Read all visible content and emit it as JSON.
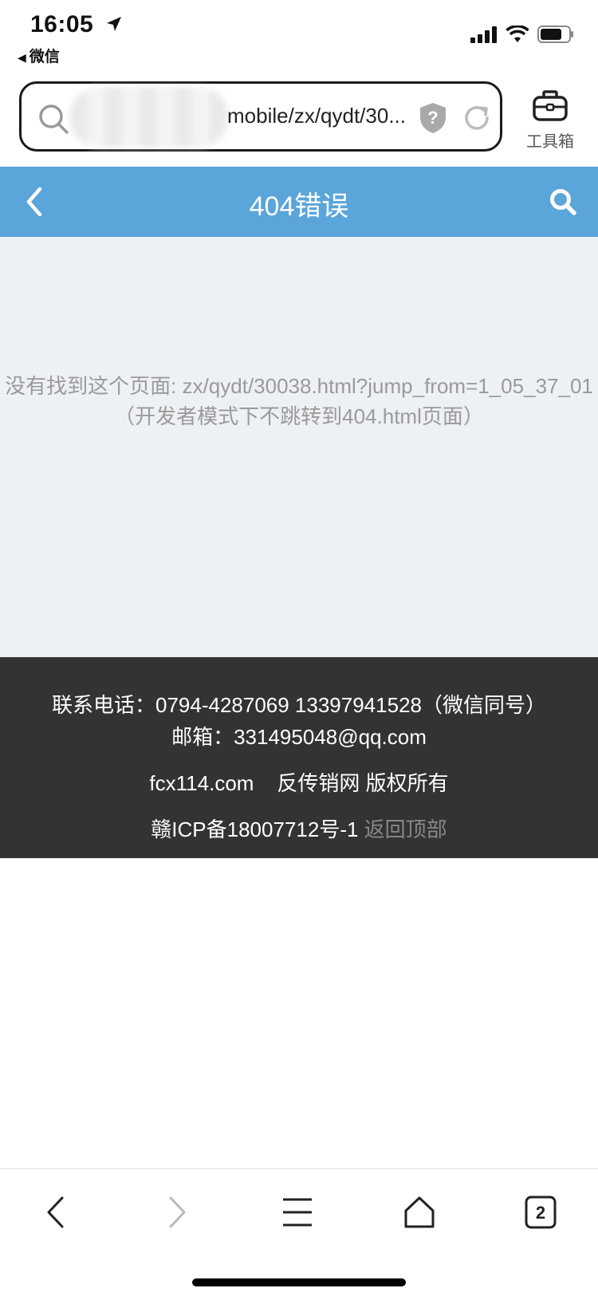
{
  "status_bar": {
    "time": "16:05",
    "back_app": "微信"
  },
  "browser": {
    "url_text": "mobile/zx/qydt/30...",
    "toolbox_label": "工具箱",
    "tabs_count": "2"
  },
  "header": {
    "title": "404错误",
    "color": "#5aa5d9"
  },
  "main": {
    "error_message": "没有找到这个页面: zx/qydt/30038.html?jump_from=1_05_37_01（开发者模式下不跳转到404.html页面）"
  },
  "footer": {
    "contact": "联系电话：0794-4287069   13397941528（微信同号）",
    "email": "邮箱：331495048@qq.com",
    "site": "fcx114.com",
    "copyright": "反传销网 版权所有",
    "icp": "赣ICP备18007712号-1",
    "back_to_top": "返回顶部"
  }
}
